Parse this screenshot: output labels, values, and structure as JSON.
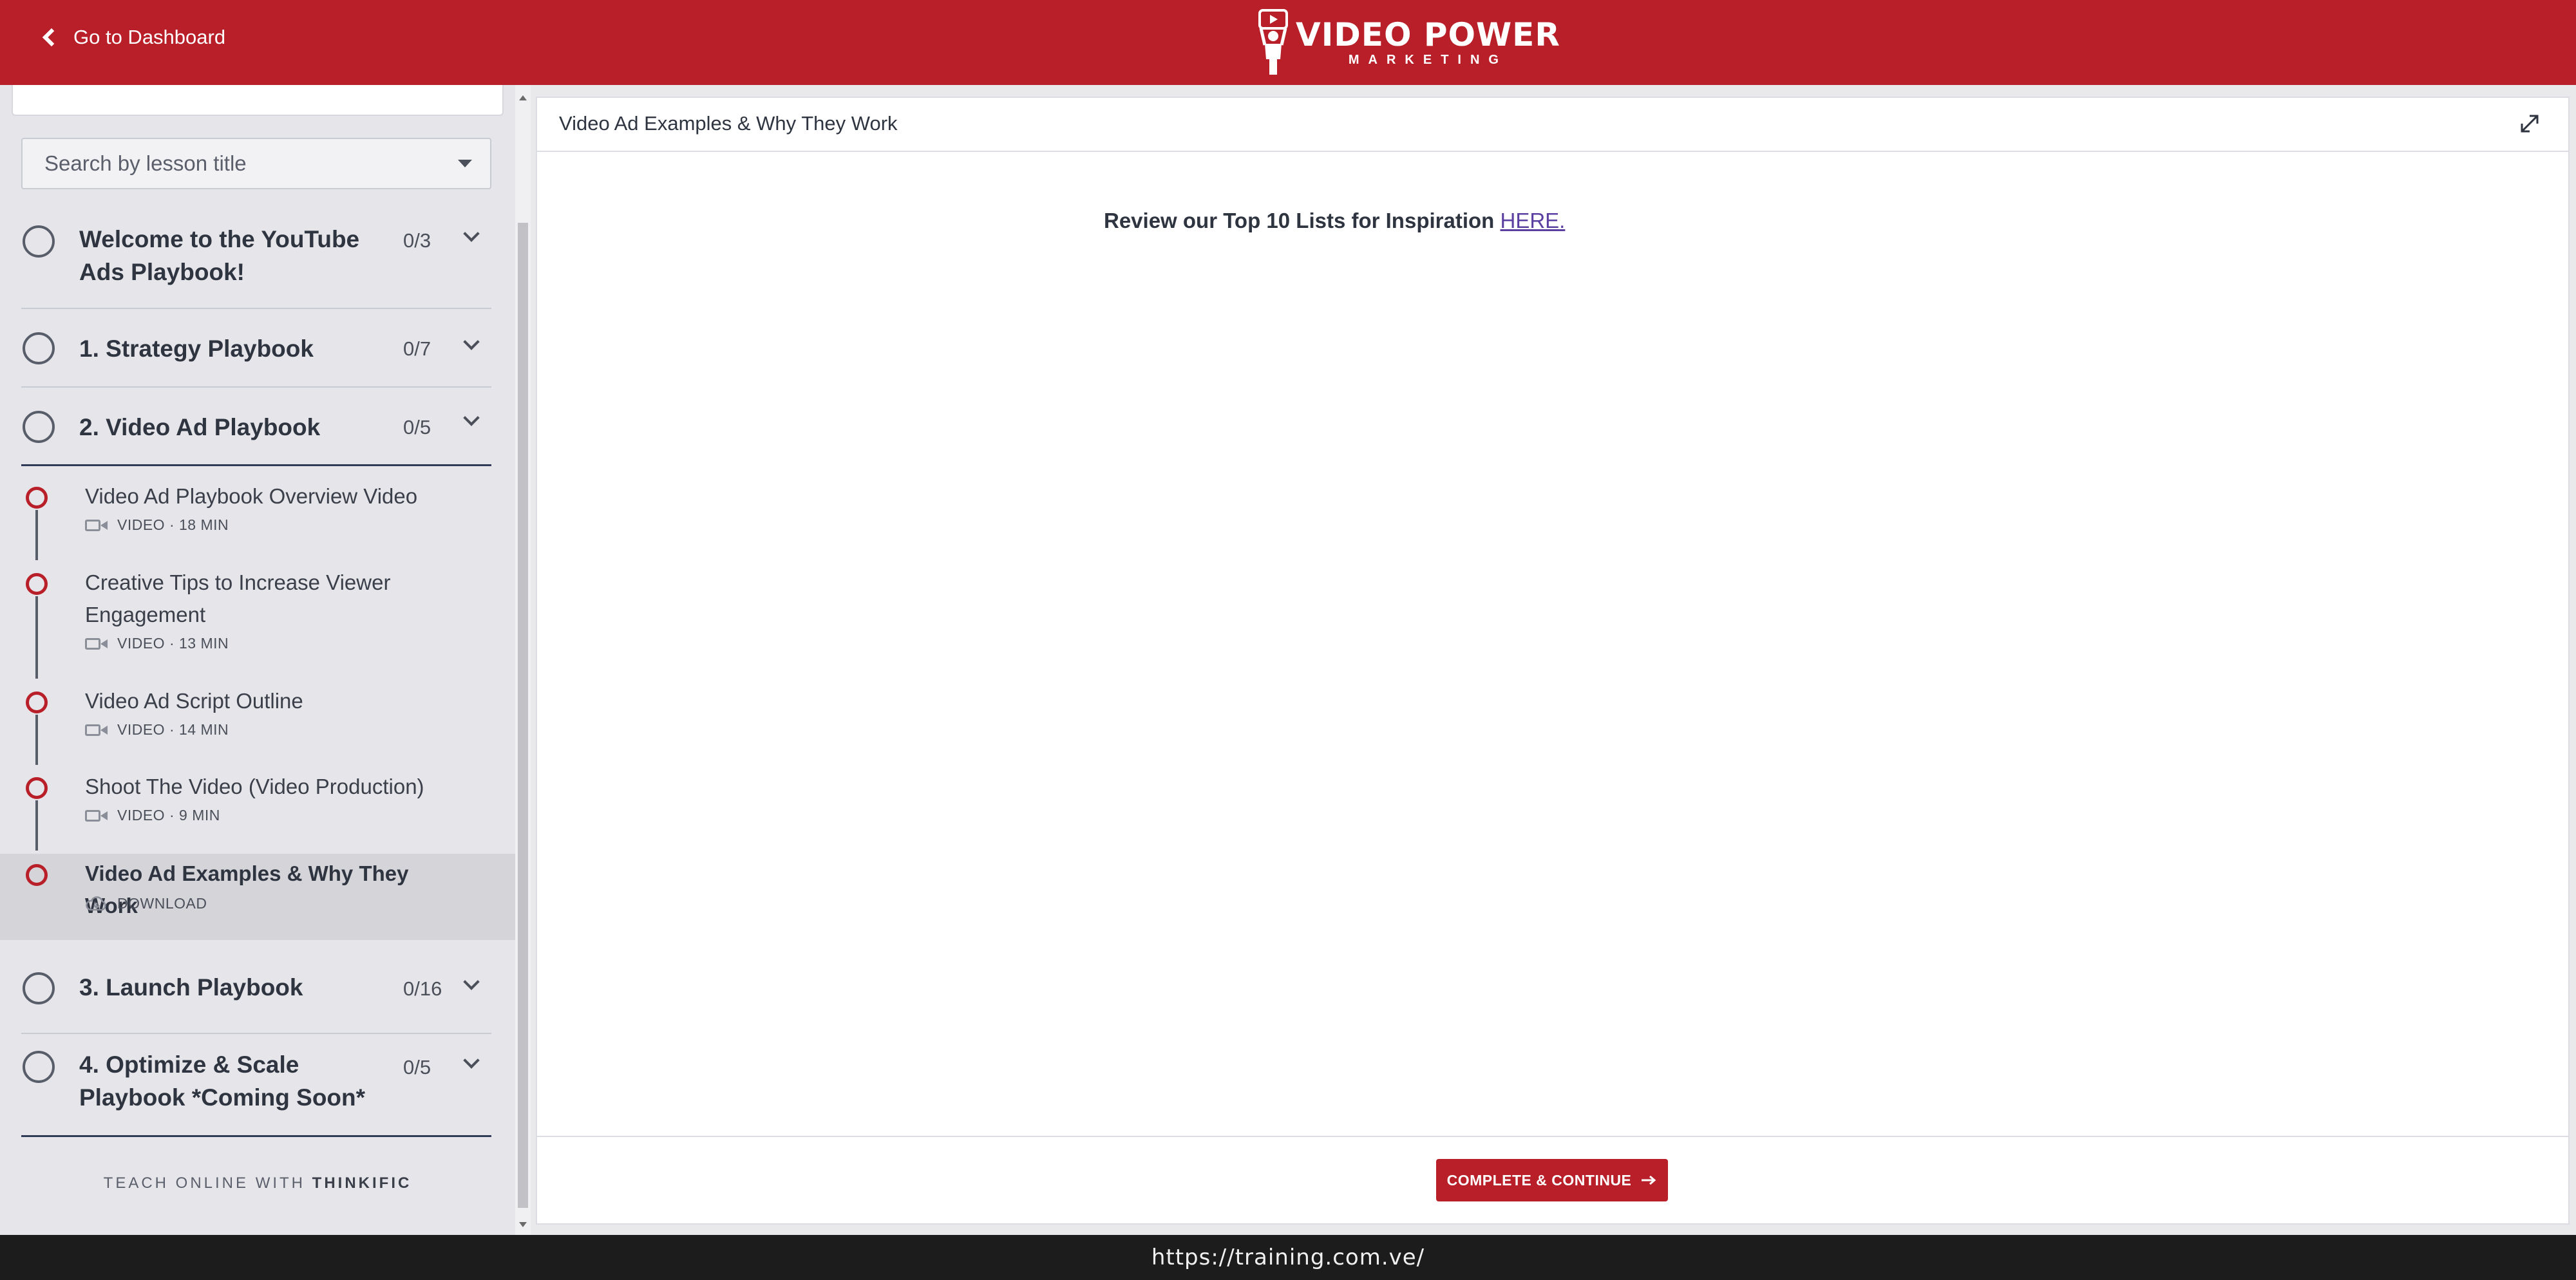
{
  "header": {
    "back_label": "Go to Dashboard",
    "logo_main": "VIDEO POWER",
    "logo_sub": "MARKETING",
    "brand_color": "#b91f28"
  },
  "sidebar": {
    "search_placeholder": "Search by lesson title",
    "chapters": [
      {
        "title": "Welcome to the YouTube Ads Playbook!",
        "count": "0/3"
      },
      {
        "title": "1. Strategy Playbook",
        "count": "0/7"
      },
      {
        "title": "2. Video Ad Playbook",
        "count": "0/5"
      },
      {
        "title": "3. Launch Playbook",
        "count": "0/16"
      },
      {
        "title": "4. Optimize & Scale Playbook *Coming Soon*",
        "count": "0/5"
      }
    ],
    "lessons": [
      {
        "title": "Video Ad Playbook Overview Video",
        "meta": "VIDEO · 18 MIN",
        "icon": "video-camera-icon"
      },
      {
        "title": "Creative Tips to Increase Viewer Engagement",
        "meta": "VIDEO · 13 MIN",
        "icon": "video-camera-icon"
      },
      {
        "title": "Video Ad Script Outline",
        "meta": "VIDEO · 14 MIN",
        "icon": "video-camera-icon"
      },
      {
        "title": "Shoot The Video (Video Production)",
        "meta": "VIDEO · 9 MIN",
        "icon": "video-camera-icon"
      },
      {
        "title": "Video Ad Examples & Why They Work",
        "meta": "DOWNLOAD",
        "icon": "cloud-download-icon"
      }
    ],
    "footer_prefix": "TEACH ONLINE WITH",
    "footer_brand": "THINKIFIC"
  },
  "content": {
    "title": "Video Ad Examples & Why They Work",
    "body_text": "Review our Top 10 Lists for Inspiration",
    "body_link": "HERE.",
    "complete_button": "COMPLETE & CONTINUE"
  },
  "url_bar": {
    "url": "https://training.com.ve/"
  }
}
